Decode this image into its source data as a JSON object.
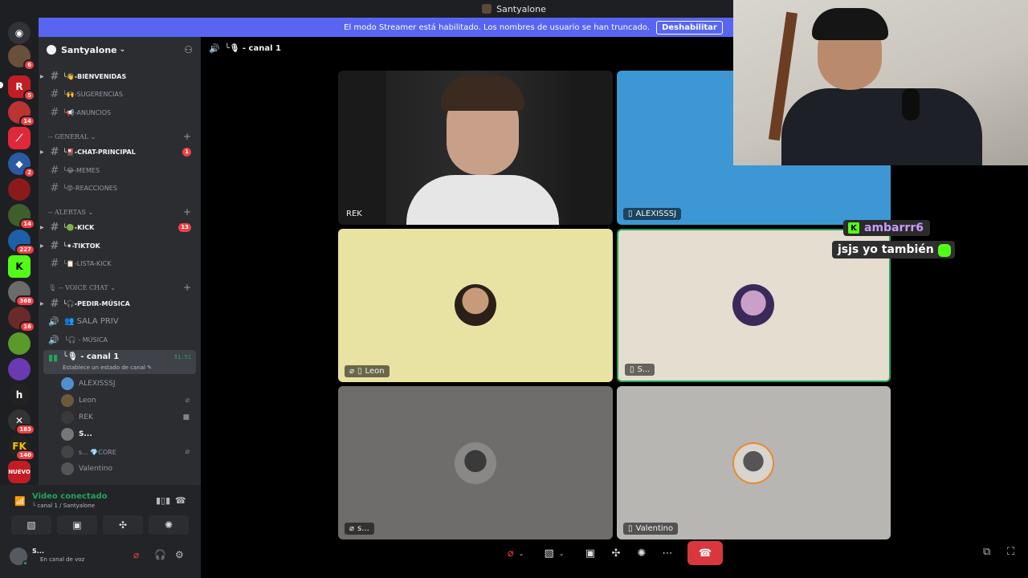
{
  "window": {
    "title": "Santyalone"
  },
  "banner": {
    "text": "El modo Streamer está habilitado. Los nombres de usuario se han truncado.",
    "button": "Deshabilitar"
  },
  "rail": {
    "badges": [
      "6",
      "1",
      "5",
      "14",
      "2",
      "14",
      "227",
      "368",
      "16",
      "183",
      "140"
    ],
    "new_label": "NUEVO"
  },
  "server": {
    "name": "Santyalone"
  },
  "channels": {
    "bienvenidas": "╰👋-BIENVENIDAS",
    "sugerencias": "╰🙌-SUGERENCIAS",
    "anuncios": "╰📢-ANUNCIOS",
    "cat_general": "-- GENERAL",
    "chat_principal": "╰🎴-CHAT-PRINCIPAL",
    "chat_principal_count": "1",
    "memes": "╰😂-MEMES",
    "reacciones": "╰😡-REACCIONES",
    "cat_alertas": "-- ALERTAS",
    "kick": "╰🟢-KICK",
    "kick_count": "13",
    "tiktok": "╰⚫-TIKTOK",
    "lista_kick": "╰📋-LISTA-KICK",
    "cat_voice": "-- VOICE CHAT",
    "pedir_musica": "╰🎧-PEDIR-MÚSICA",
    "sala_priv": "👥 SALA PRIV",
    "musica": "╰🎧 - MÚSICA",
    "canal1": "╰🎙 - canal 1",
    "canal1_status": "Establece un estado de canal ✎",
    "canal1_time": "51:51"
  },
  "members": [
    {
      "name": "ALEXISSSJ",
      "color": "#4f8fcf"
    },
    {
      "name": "Leon",
      "color": "#6b5a3a"
    },
    {
      "name": "REK",
      "color": "#3a3a3a"
    },
    {
      "name": "S...",
      "color": "#777"
    },
    {
      "name": "s... 💎CORE",
      "color": "#444"
    },
    {
      "name": "Valentino",
      "color": "#555"
    }
  ],
  "voice": {
    "status": "Video conectado",
    "location": "╰ canal 1 / Santyalone"
  },
  "user": {
    "name": "S...",
    "status": "En canal de voz"
  },
  "stage": {
    "header": "╰🎙 - canal 1",
    "tiles": [
      {
        "label": "REK",
        "bg": "#1a1a1a"
      },
      {
        "label": "ALEXISSSJ",
        "bg": "#3d97d4"
      },
      {
        "label": "Leon",
        "bg": "#e9e3a3"
      },
      {
        "label": "S...",
        "bg": "#e4ddd0"
      },
      {
        "label": "s...",
        "bg": "#6f6d6b"
      },
      {
        "label": "Valentino",
        "bg": "#b8b6b3"
      }
    ]
  },
  "chat_overlay": {
    "username": "ambarrr6",
    "message": "jsjs yo también"
  },
  "colors": {
    "accent": "#5865f2",
    "danger": "#da373c",
    "online": "#23a55a",
    "speaking": "#23a55a"
  }
}
